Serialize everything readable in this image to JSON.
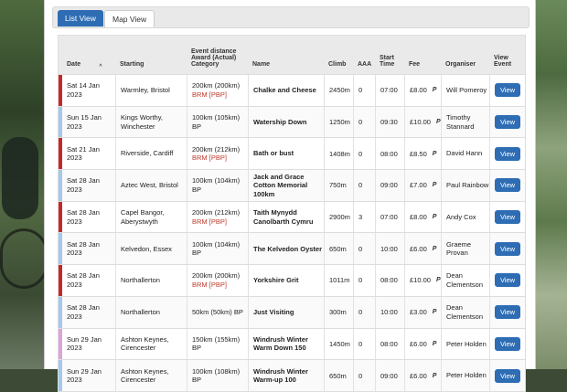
{
  "tabs": [
    {
      "label": "List View",
      "active": true
    },
    {
      "label": "Map View",
      "active": false
    }
  ],
  "columns": {
    "date": "Date",
    "starting": "Starting",
    "distance": [
      "Event distance",
      "Award (Actual)",
      "Category"
    ],
    "name": "Name",
    "climb": "Climb",
    "aaa": "AAA",
    "start_time": [
      "Start",
      "Time"
    ],
    "fee": "Fee",
    "organiser": "Organiser",
    "view_event": [
      "View",
      "Event"
    ]
  },
  "sort_indicator": "^",
  "paypal_icon": "paypal-icon",
  "colors": {
    "accent": "#2e6db4",
    "brm": "#c0392b",
    "row_red": "#c62828",
    "row_blue": "#a5c9ea",
    "row_purple": "#d9a6d9"
  },
  "rows": [
    {
      "date": "Sat 14 Jan 2023",
      "starting": "Warmley, Bristol",
      "distance": "200km (200km)",
      "category": "BRM [PBP]",
      "category_brm": true,
      "name": "Chalke and Cheese",
      "climb": "2450m",
      "aaa": "0",
      "time": "07:00",
      "fee": "£8.00",
      "organiser": "Will Pomeroy",
      "view": "View",
      "color": "#c62828"
    },
    {
      "date": "Sun 15 Jan 2023",
      "starting": "Kings Worthy, Winchester",
      "distance": "100km (105km)",
      "category": "BP",
      "category_brm": false,
      "name": "Watership Down",
      "climb": "1250m",
      "aaa": "0",
      "time": "09:30",
      "fee": "£10.00",
      "organiser": "Timothy Stannard",
      "view": "View",
      "color": "#a5c9ea"
    },
    {
      "date": "Sat 21 Jan 2023",
      "starting": "Riverside, Cardiff",
      "distance": "200km (212km)",
      "category": "BRM [PBP]",
      "category_brm": true,
      "name": "Bath or bust",
      "climb": "1408m",
      "aaa": "0",
      "time": "08:00",
      "fee": "£8.50",
      "organiser": "David Hann",
      "view": "View",
      "color": "#c62828"
    },
    {
      "date": "Sat 28 Jan 2023",
      "starting": "Aztec West, Bristol",
      "distance": "100km (104km)",
      "category": "BP",
      "category_brm": false,
      "name": "Jack and Grace Cotton Memorial 100km",
      "climb": "750m",
      "aaa": "0",
      "time": "09:00",
      "fee": "£7.00",
      "organiser": "Paul Rainbow",
      "view": "View",
      "color": "#a5c9ea"
    },
    {
      "date": "Sat 28 Jan 2023",
      "starting": "Capel Bangor, Aberystwyth",
      "distance": "200km (212km)",
      "category": "BRM [PBP]",
      "category_brm": true,
      "name": "Taith Mynydd Canolbarth Cymru",
      "climb": "2900m",
      "aaa": "3",
      "time": "07:00",
      "fee": "£8.00",
      "organiser": "Andy Cox",
      "view": "View",
      "color": "#c62828"
    },
    {
      "date": "Sat 28 Jan 2023",
      "starting": "Kelvedon, Essex",
      "distance": "100km (104km)",
      "category": "BP",
      "category_brm": false,
      "name": "The Kelvedon Oyster",
      "climb": "650m",
      "aaa": "0",
      "time": "10:00",
      "fee": "£6.00",
      "organiser": "Graeme Provan",
      "view": "View",
      "color": "#a5c9ea"
    },
    {
      "date": "Sat 28 Jan 2023",
      "starting": "Northallerton",
      "distance": "200km (200km)",
      "category": "BRM [PBP]",
      "category_brm": true,
      "name": "Yorkshire Grit",
      "climb": "1011m",
      "aaa": "0",
      "time": "08:00",
      "fee": "£10.00",
      "organiser": "Dean Clementson",
      "view": "View",
      "color": "#c62828"
    },
    {
      "date": "Sat 28 Jan 2023",
      "starting": "Northallerton",
      "distance": "50km (50km) BP",
      "category": "",
      "category_brm": false,
      "name": "Just Visiting",
      "climb": "300m",
      "aaa": "0",
      "time": "10:00",
      "fee": "£3.00",
      "organiser": "Dean Clementson",
      "view": "View",
      "color": "#a5c9ea"
    },
    {
      "date": "Sun 29 Jan 2023",
      "starting": "Ashton Keynes, Cirencester",
      "distance": "150km (155km)",
      "category": "BP",
      "category_brm": false,
      "name": "Windrush Winter Warm Down 150",
      "climb": "1450m",
      "aaa": "0",
      "time": "08:00",
      "fee": "£6.00",
      "organiser": "Peter Holden",
      "view": "View",
      "color": "#d9a6d9"
    },
    {
      "date": "Sun 29 Jan 2023",
      "starting": "Ashton Keynes, Cirencester",
      "distance": "100km (108km)",
      "category": "BP",
      "category_brm": false,
      "name": "Windrush Winter Warm-up 100",
      "climb": "650m",
      "aaa": "0",
      "time": "09:00",
      "fee": "£6.00",
      "organiser": "Peter Holden",
      "view": "View",
      "color": "#a5c9ea"
    }
  ]
}
